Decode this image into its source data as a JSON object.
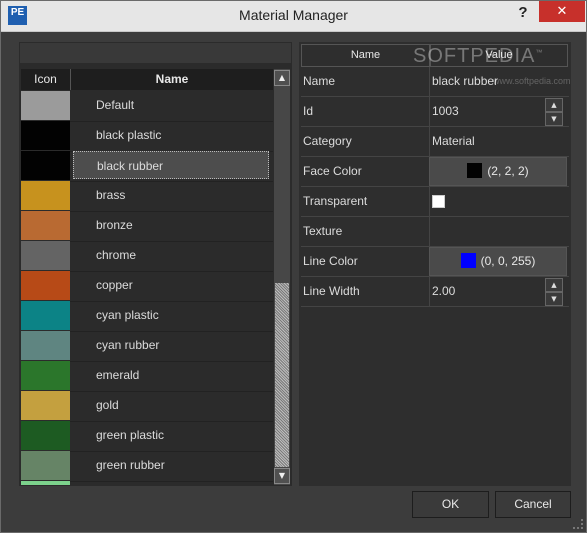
{
  "window": {
    "title": "Material Manager",
    "app_icon_text": "PE",
    "help_glyph": "?",
    "close_glyph": "✕"
  },
  "materials_list": {
    "columns": {
      "icon": "Icon",
      "name": "Name"
    },
    "selected_index": 2,
    "items": [
      {
        "name": "Default",
        "color": "#9b9b9b"
      },
      {
        "name": "black plastic",
        "color": "#020202"
      },
      {
        "name": "black rubber",
        "color": "#020202"
      },
      {
        "name": "brass",
        "color": "#c7921e"
      },
      {
        "name": "bronze",
        "color": "#b96a32"
      },
      {
        "name": "chrome",
        "color": "#646464"
      },
      {
        "name": "copper",
        "color": "#b74a17"
      },
      {
        "name": "cyan plastic",
        "color": "#0c8386"
      },
      {
        "name": "cyan rubber",
        "color": "#5f8581"
      },
      {
        "name": "emerald",
        "color": "#2b762b"
      },
      {
        "name": "gold",
        "color": "#c4a03f"
      },
      {
        "name": "green plastic",
        "color": "#1d5b22"
      },
      {
        "name": "green rubber",
        "color": "#668466"
      },
      {
        "name": "",
        "color": "#7cd28c"
      }
    ]
  },
  "properties": {
    "columns": {
      "name": "Name",
      "value": "Value"
    },
    "rows": {
      "name": {
        "label": "Name",
        "value": "black rubber"
      },
      "id": {
        "label": "Id",
        "value": "1003"
      },
      "category": {
        "label": "Category",
        "value": "Material"
      },
      "face_color": {
        "label": "Face Color",
        "value": "(2, 2, 2)",
        "swatch": "#020202"
      },
      "transparent": {
        "label": "Transparent",
        "checked": false
      },
      "texture": {
        "label": "Texture",
        "value": ""
      },
      "line_color": {
        "label": "Line Color",
        "value": "(0, 0, 255)",
        "swatch": "#0000ff"
      },
      "line_width": {
        "label": "Line Width",
        "value": "2.00"
      }
    }
  },
  "watermark": {
    "text": "SOFTPEDIA",
    "tm": "™",
    "sub": "www.softpedia.com"
  },
  "buttons": {
    "ok": "OK",
    "cancel": "Cancel"
  }
}
